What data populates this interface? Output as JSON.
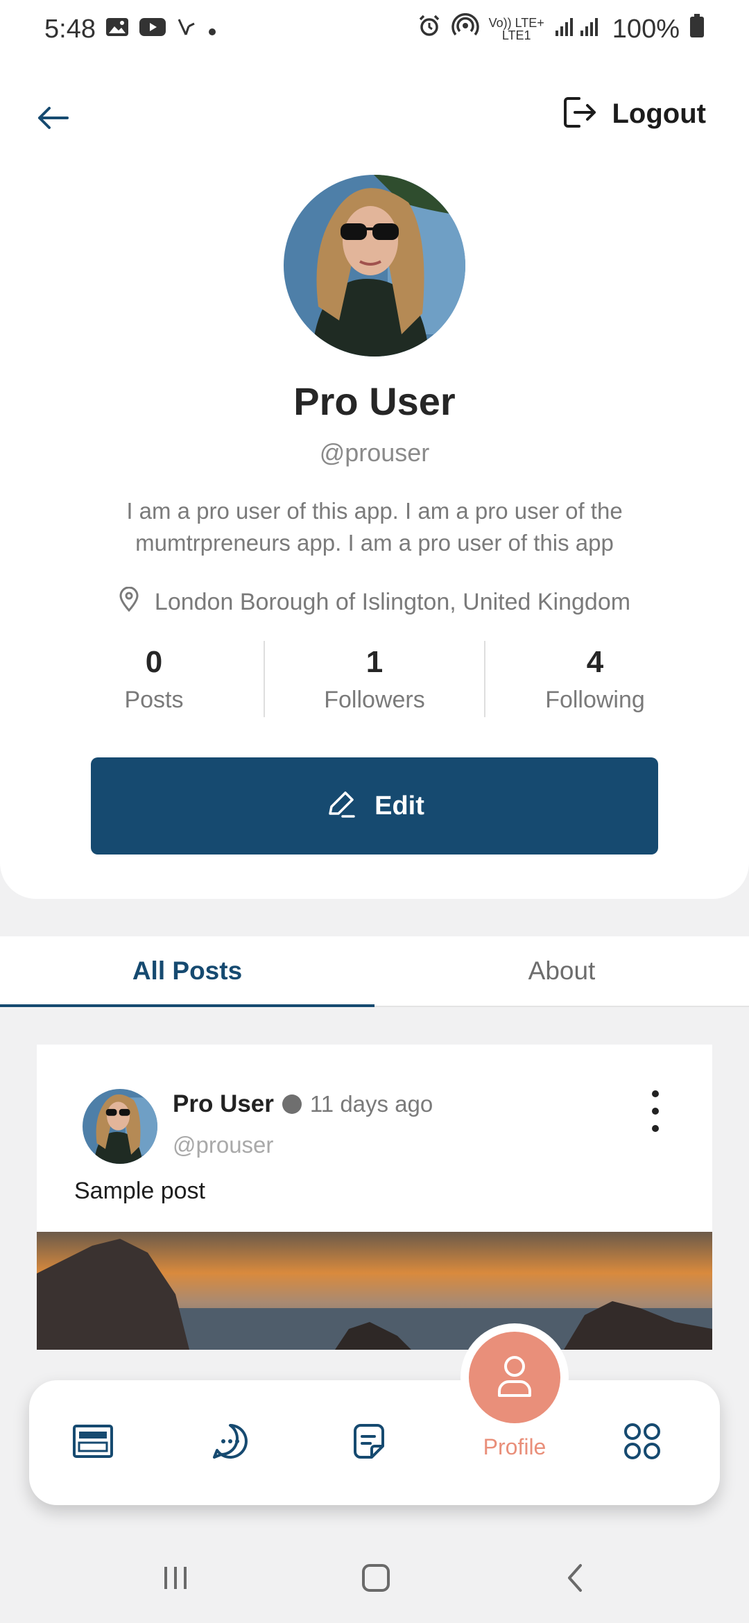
{
  "status_bar": {
    "time": "5:48",
    "battery": "100%",
    "network_top": "Vo)) LTE+",
    "network_bottom": "LTE1"
  },
  "header": {
    "logout_label": "Logout"
  },
  "profile": {
    "name": "Pro User",
    "handle": "@prouser",
    "bio": "I am a pro user of this app. I am a pro user of the mumtrpreneurs app. I am a pro user of this app",
    "location": "London Borough of Islington, United Kingdom",
    "stats": [
      {
        "count": "0",
        "label": "Posts"
      },
      {
        "count": "1",
        "label": "Followers"
      },
      {
        "count": "4",
        "label": "Following"
      }
    ],
    "edit_label": "Edit"
  },
  "tabs": [
    {
      "label": "All Posts",
      "active": true
    },
    {
      "label": "About",
      "active": false
    }
  ],
  "post": {
    "author": "Pro User",
    "time": "11 days ago",
    "handle": "@prouser",
    "text": "Sample post"
  },
  "bottom_nav": {
    "items": [
      {
        "icon": "feed-icon"
      },
      {
        "icon": "chat-icon"
      },
      {
        "icon": "note-icon"
      },
      {
        "icon": "profile-icon",
        "label": "Profile",
        "active": true
      },
      {
        "icon": "apps-grid-icon"
      }
    ]
  },
  "colors": {
    "primary": "#164a70",
    "accent": "#e98f7a",
    "background": "#f1f1f2"
  }
}
